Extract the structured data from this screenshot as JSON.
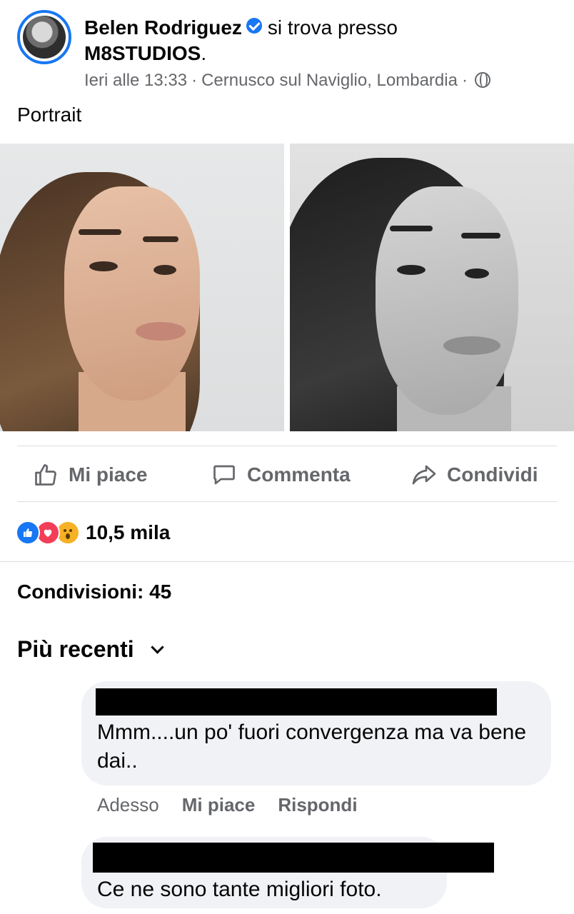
{
  "post": {
    "author": "Belen Rodriguez",
    "verb": "si trova presso",
    "place": "M8STUDIOS",
    "place_suffix": ".",
    "time": "Ieri alle 13:33",
    "separator": "·",
    "location": "Cernusco sul Naviglio, Lombardia",
    "privacy_icon": "globe-icon",
    "caption": "Portrait"
  },
  "actions": {
    "like": "Mi piace",
    "comment": "Commenta",
    "share": "Condividi"
  },
  "reactions": {
    "types": [
      "like",
      "love",
      "wow"
    ],
    "count": "10,5 mila"
  },
  "shares_text": "Condivisioni: 45",
  "sort_label": "Più recenti",
  "comments": [
    {
      "text": "Mmm....un po' fuori convergenza ma va bene dai..",
      "time": "Adesso",
      "like": "Mi piace",
      "reply": "Rispondi"
    },
    {
      "text": "Ce ne sono tante migliori foto."
    }
  ],
  "colors": {
    "accent": "#1877f2",
    "secondary_text": "#65676b",
    "bubble": "#f0f2f5"
  }
}
